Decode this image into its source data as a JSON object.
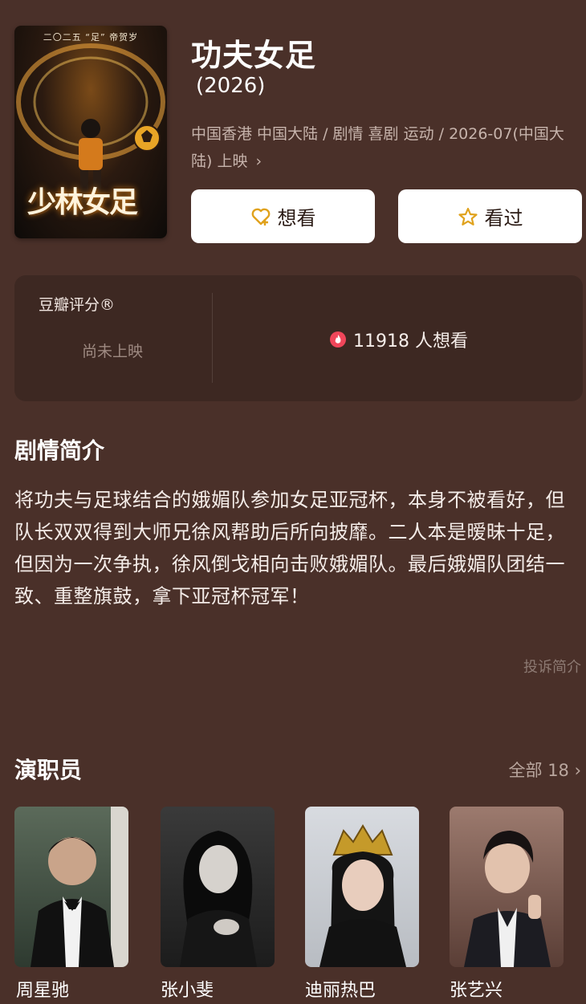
{
  "movie": {
    "title": "功夫女足",
    "year": "(2026)",
    "meta_line": "中国香港 中国大陆 / 剧情 喜剧 运动 / 2026-07(中国大陆) 上映",
    "meta_chevron": "›",
    "poster": {
      "top_text": "二〇二五 “足” 帝贺岁",
      "title_art": "少林女足"
    }
  },
  "actions": {
    "want_label": "想看",
    "seen_label": "看过"
  },
  "rating": {
    "label": "豆瓣评分®",
    "status": "尚未上映",
    "want_count_text": "11918 人想看"
  },
  "synopsis": {
    "title": "剧情简介",
    "text": "将功夫与足球结合的娥媚队参加女足亚冠杯，本身不被看好，但队长双双得到大师兄徐风帮助后所向披靡。二人本是暧昧十足，但因为一次争执，徐风倒戈相向击败娥媚队。最后娥媚队团结一致、重整旗鼓，拿下亚冠杯冠军！",
    "report_link": "投诉简介"
  },
  "cast": {
    "title": "演职员",
    "all_label": "全部 18 ›",
    "members": [
      {
        "name": "周星驰"
      },
      {
        "name": "张小斐"
      },
      {
        "name": "迪丽热巴"
      },
      {
        "name": "张艺兴"
      }
    ]
  },
  "colors": {
    "background": "#4a3029",
    "card": "#3d2822",
    "accent_gold": "#e0a21d",
    "flame_red": "#f0465a"
  },
  "icons": {
    "want": "heart-plus-icon",
    "seen": "star-icon",
    "flame": "flame-icon",
    "chevron": "chevron-right-icon"
  }
}
